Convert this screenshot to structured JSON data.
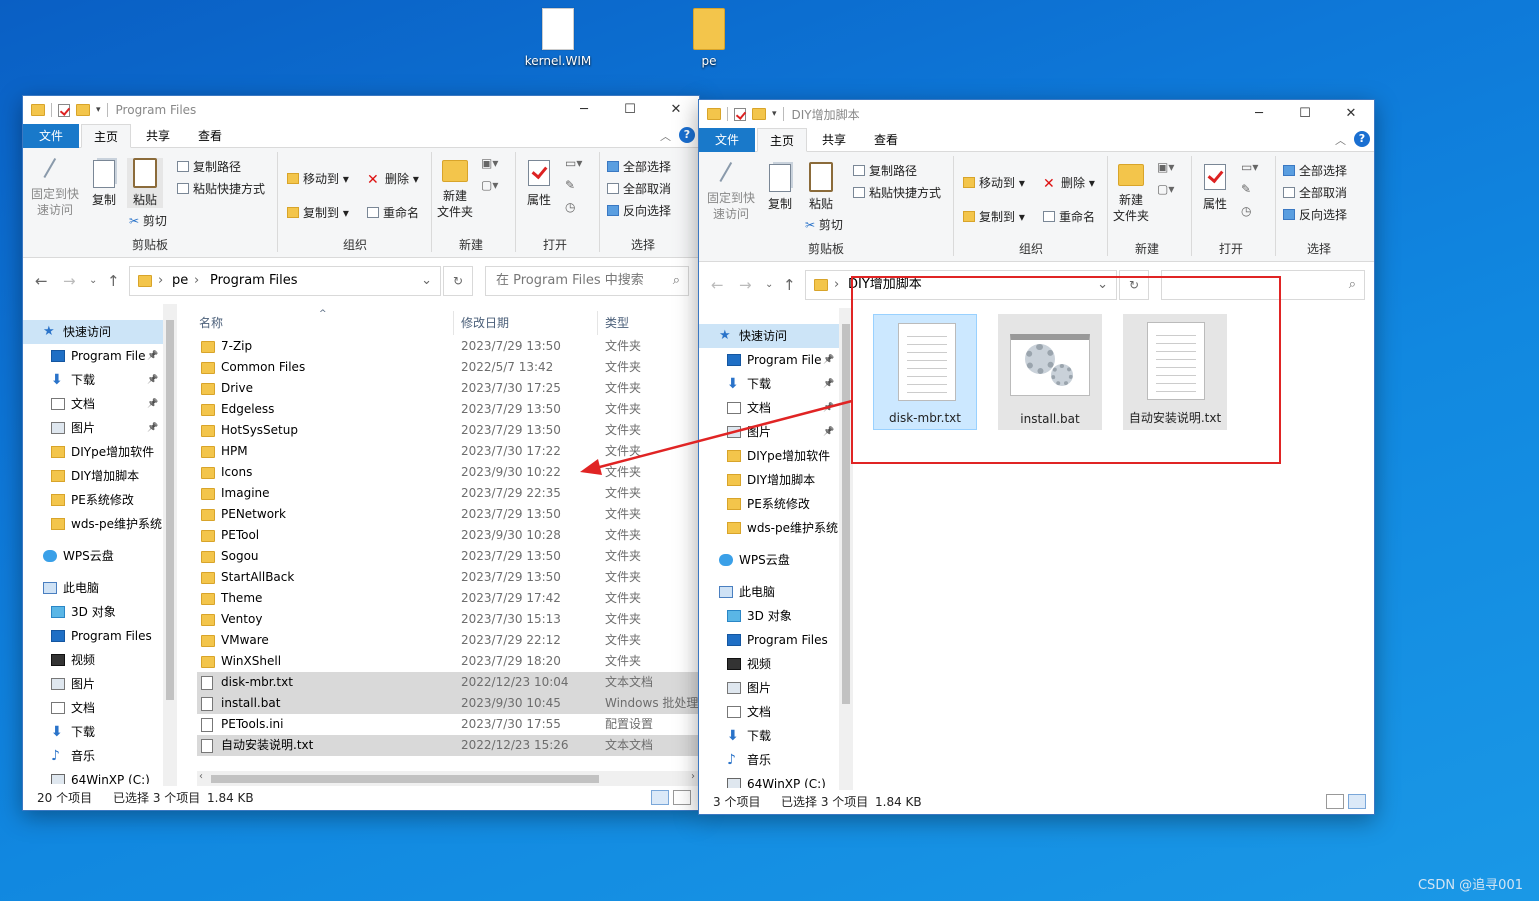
{
  "desktop": {
    "icons": [
      {
        "label": "kernel.WIM",
        "icon": "file-icon"
      },
      {
        "label": "pe",
        "icon": "folder-icon"
      }
    ],
    "watermark": "CSDN @追寻001"
  },
  "left_window": {
    "title": "Program Files",
    "controls": {
      "minimize": "─",
      "maximize": "☐",
      "close": "✕"
    },
    "tabs": [
      "文件",
      "主页",
      "共享",
      "查看"
    ],
    "ribbon": {
      "pin_label_1": "固定到快",
      "pin_label_2": "速访问",
      "copy": "复制",
      "paste": "粘贴",
      "copy_path": "复制路径",
      "paste_shortcut": "粘贴快捷方式",
      "cut": "剪切",
      "move_to": "移动到",
      "delete": "删除",
      "copy_to": "复制到",
      "rename": "重命名",
      "new_folder_1": "新建",
      "new_folder_2": "文件夹",
      "properties": "属性",
      "select_all": "全部选择",
      "select_none": "全部取消",
      "invert_selection": "反向选择",
      "groups": [
        "剪贴板",
        "组织",
        "新建",
        "打开",
        "选择"
      ]
    },
    "breadcrumb": [
      "pe",
      "Program Files"
    ],
    "search_placeholder": "在 Program Files 中搜索",
    "nav": [
      {
        "label": "快速访问",
        "icon": "star-icon"
      },
      {
        "label": "Program File",
        "icon": "blue-folder-icon",
        "pinned": true
      },
      {
        "label": "下载",
        "icon": "download-icon",
        "pinned": true
      },
      {
        "label": "文档",
        "icon": "documents-icon",
        "pinned": true
      },
      {
        "label": "图片",
        "icon": "pictures-icon",
        "pinned": true
      },
      {
        "label": "DIYpe增加软件",
        "icon": "folder-icon"
      },
      {
        "label": "DIY增加脚本",
        "icon": "folder-icon"
      },
      {
        "label": "PE系统修改",
        "icon": "folder-icon"
      },
      {
        "label": "wds-pe维护系统",
        "icon": "folder-icon"
      },
      {
        "label": "WPS云盘",
        "icon": "cloud-icon"
      },
      {
        "label": "此电脑",
        "icon": "computer-icon"
      },
      {
        "label": "3D 对象",
        "icon": "cube-icon"
      },
      {
        "label": "Program Files",
        "icon": "blue-folder-icon"
      },
      {
        "label": "视频",
        "icon": "video-icon"
      },
      {
        "label": "图片",
        "icon": "pictures-icon"
      },
      {
        "label": "文档",
        "icon": "documents-icon"
      },
      {
        "label": "下载",
        "icon": "download-icon"
      },
      {
        "label": "音乐",
        "icon": "music-icon"
      },
      {
        "label": "64WinXP (C:)",
        "icon": "drive-icon"
      }
    ],
    "columns": [
      "名称",
      "修改日期",
      "类型"
    ],
    "files": [
      {
        "name": "7-Zip",
        "date": "2023/7/29 13:50",
        "type": "文件夹",
        "kind": "folder",
        "selected": false
      },
      {
        "name": "Common Files",
        "date": "2022/5/7 13:42",
        "type": "文件夹",
        "kind": "folder",
        "selected": false
      },
      {
        "name": "Drive",
        "date": "2023/7/30 17:25",
        "type": "文件夹",
        "kind": "folder",
        "selected": false
      },
      {
        "name": "Edgeless",
        "date": "2023/7/29 13:50",
        "type": "文件夹",
        "kind": "folder",
        "selected": false
      },
      {
        "name": "HotSysSetup",
        "date": "2023/7/29 13:50",
        "type": "文件夹",
        "kind": "folder",
        "selected": false
      },
      {
        "name": "HPM",
        "date": "2023/7/30 17:22",
        "type": "文件夹",
        "kind": "folder",
        "selected": false
      },
      {
        "name": "Icons",
        "date": "2023/9/30 10:22",
        "type": "文件夹",
        "kind": "folder",
        "selected": false
      },
      {
        "name": "Imagine",
        "date": "2023/7/29 22:35",
        "type": "文件夹",
        "kind": "folder",
        "selected": false
      },
      {
        "name": "PENetwork",
        "date": "2023/7/29 13:50",
        "type": "文件夹",
        "kind": "folder",
        "selected": false
      },
      {
        "name": "PETool",
        "date": "2023/9/30 10:28",
        "type": "文件夹",
        "kind": "folder",
        "selected": false
      },
      {
        "name": "Sogou",
        "date": "2023/7/29 13:50",
        "type": "文件夹",
        "kind": "folder",
        "selected": false
      },
      {
        "name": "StartAllBack",
        "date": "2023/7/29 13:50",
        "type": "文件夹",
        "kind": "folder",
        "selected": false
      },
      {
        "name": "Theme",
        "date": "2023/7/29 17:42",
        "type": "文件夹",
        "kind": "folder",
        "selected": false
      },
      {
        "name": "Ventoy",
        "date": "2023/7/30 15:13",
        "type": "文件夹",
        "kind": "folder",
        "selected": false
      },
      {
        "name": "VMware",
        "date": "2023/7/29 22:12",
        "type": "文件夹",
        "kind": "folder",
        "selected": false
      },
      {
        "name": "WinXShell",
        "date": "2023/7/29 18:20",
        "type": "文件夹",
        "kind": "folder",
        "selected": false
      },
      {
        "name": "disk-mbr.txt",
        "date": "2022/12/23 10:04",
        "type": "文本文档",
        "kind": "file",
        "selected": true
      },
      {
        "name": "install.bat",
        "date": "2023/9/30 10:45",
        "type": "Windows 批处理",
        "kind": "file",
        "selected": true
      },
      {
        "name": "PETools.ini",
        "date": "2023/7/30 17:55",
        "type": "配置设置",
        "kind": "file",
        "selected": false
      },
      {
        "name": "自动安装说明.txt",
        "date": "2022/12/23 15:26",
        "type": "文本文档",
        "kind": "file",
        "selected": true
      }
    ],
    "status": {
      "count": "20 个项目",
      "selected": "已选择 3 个项目",
      "size": "1.84 KB"
    }
  },
  "right_window": {
    "title": "DIY增加脚本",
    "controls": {
      "minimize": "─",
      "maximize": "☐",
      "close": "✕"
    },
    "tabs": [
      "文件",
      "主页",
      "共享",
      "查看"
    ],
    "breadcrumb": [
      "DIY增加脚本"
    ],
    "nav": [
      {
        "label": "快速访问",
        "icon": "star-icon"
      },
      {
        "label": "Program File",
        "icon": "blue-folder-icon",
        "pinned": true
      },
      {
        "label": "下载",
        "icon": "download-icon",
        "pinned": true
      },
      {
        "label": "文档",
        "icon": "documents-icon",
        "pinned": true
      },
      {
        "label": "图片",
        "icon": "pictures-icon",
        "pinned": true
      },
      {
        "label": "DIYpe增加软件",
        "icon": "folder-icon"
      },
      {
        "label": "DIY增加脚本",
        "icon": "folder-icon"
      },
      {
        "label": "PE系统修改",
        "icon": "folder-icon"
      },
      {
        "label": "wds-pe维护系统",
        "icon": "folder-icon"
      },
      {
        "label": "WPS云盘",
        "icon": "cloud-icon"
      },
      {
        "label": "此电脑",
        "icon": "computer-icon"
      },
      {
        "label": "3D 对象",
        "icon": "cube-icon"
      },
      {
        "label": "Program Files",
        "icon": "blue-folder-icon"
      },
      {
        "label": "视频",
        "icon": "video-icon"
      },
      {
        "label": "图片",
        "icon": "pictures-icon"
      },
      {
        "label": "文档",
        "icon": "documents-icon"
      },
      {
        "label": "下载",
        "icon": "download-icon"
      },
      {
        "label": "音乐",
        "icon": "music-icon"
      },
      {
        "label": "64WinXP (C:)",
        "icon": "drive-icon"
      }
    ],
    "tiles": [
      {
        "name": "disk-mbr.txt",
        "kind": "txt",
        "selected": true
      },
      {
        "name": "install.bat",
        "kind": "bat",
        "selected": false
      },
      {
        "name": "自动安装说明.txt",
        "kind": "txt",
        "selected": false
      }
    ],
    "status": {
      "count": "3 个项目",
      "selected": "已选择 3 个项目",
      "size": "1.84 KB"
    }
  },
  "colors": {
    "accent": "#1979ca",
    "selection": "#cce4f7",
    "annotation_red": "#e02424",
    "desktop_blue": "#0e78d8"
  }
}
